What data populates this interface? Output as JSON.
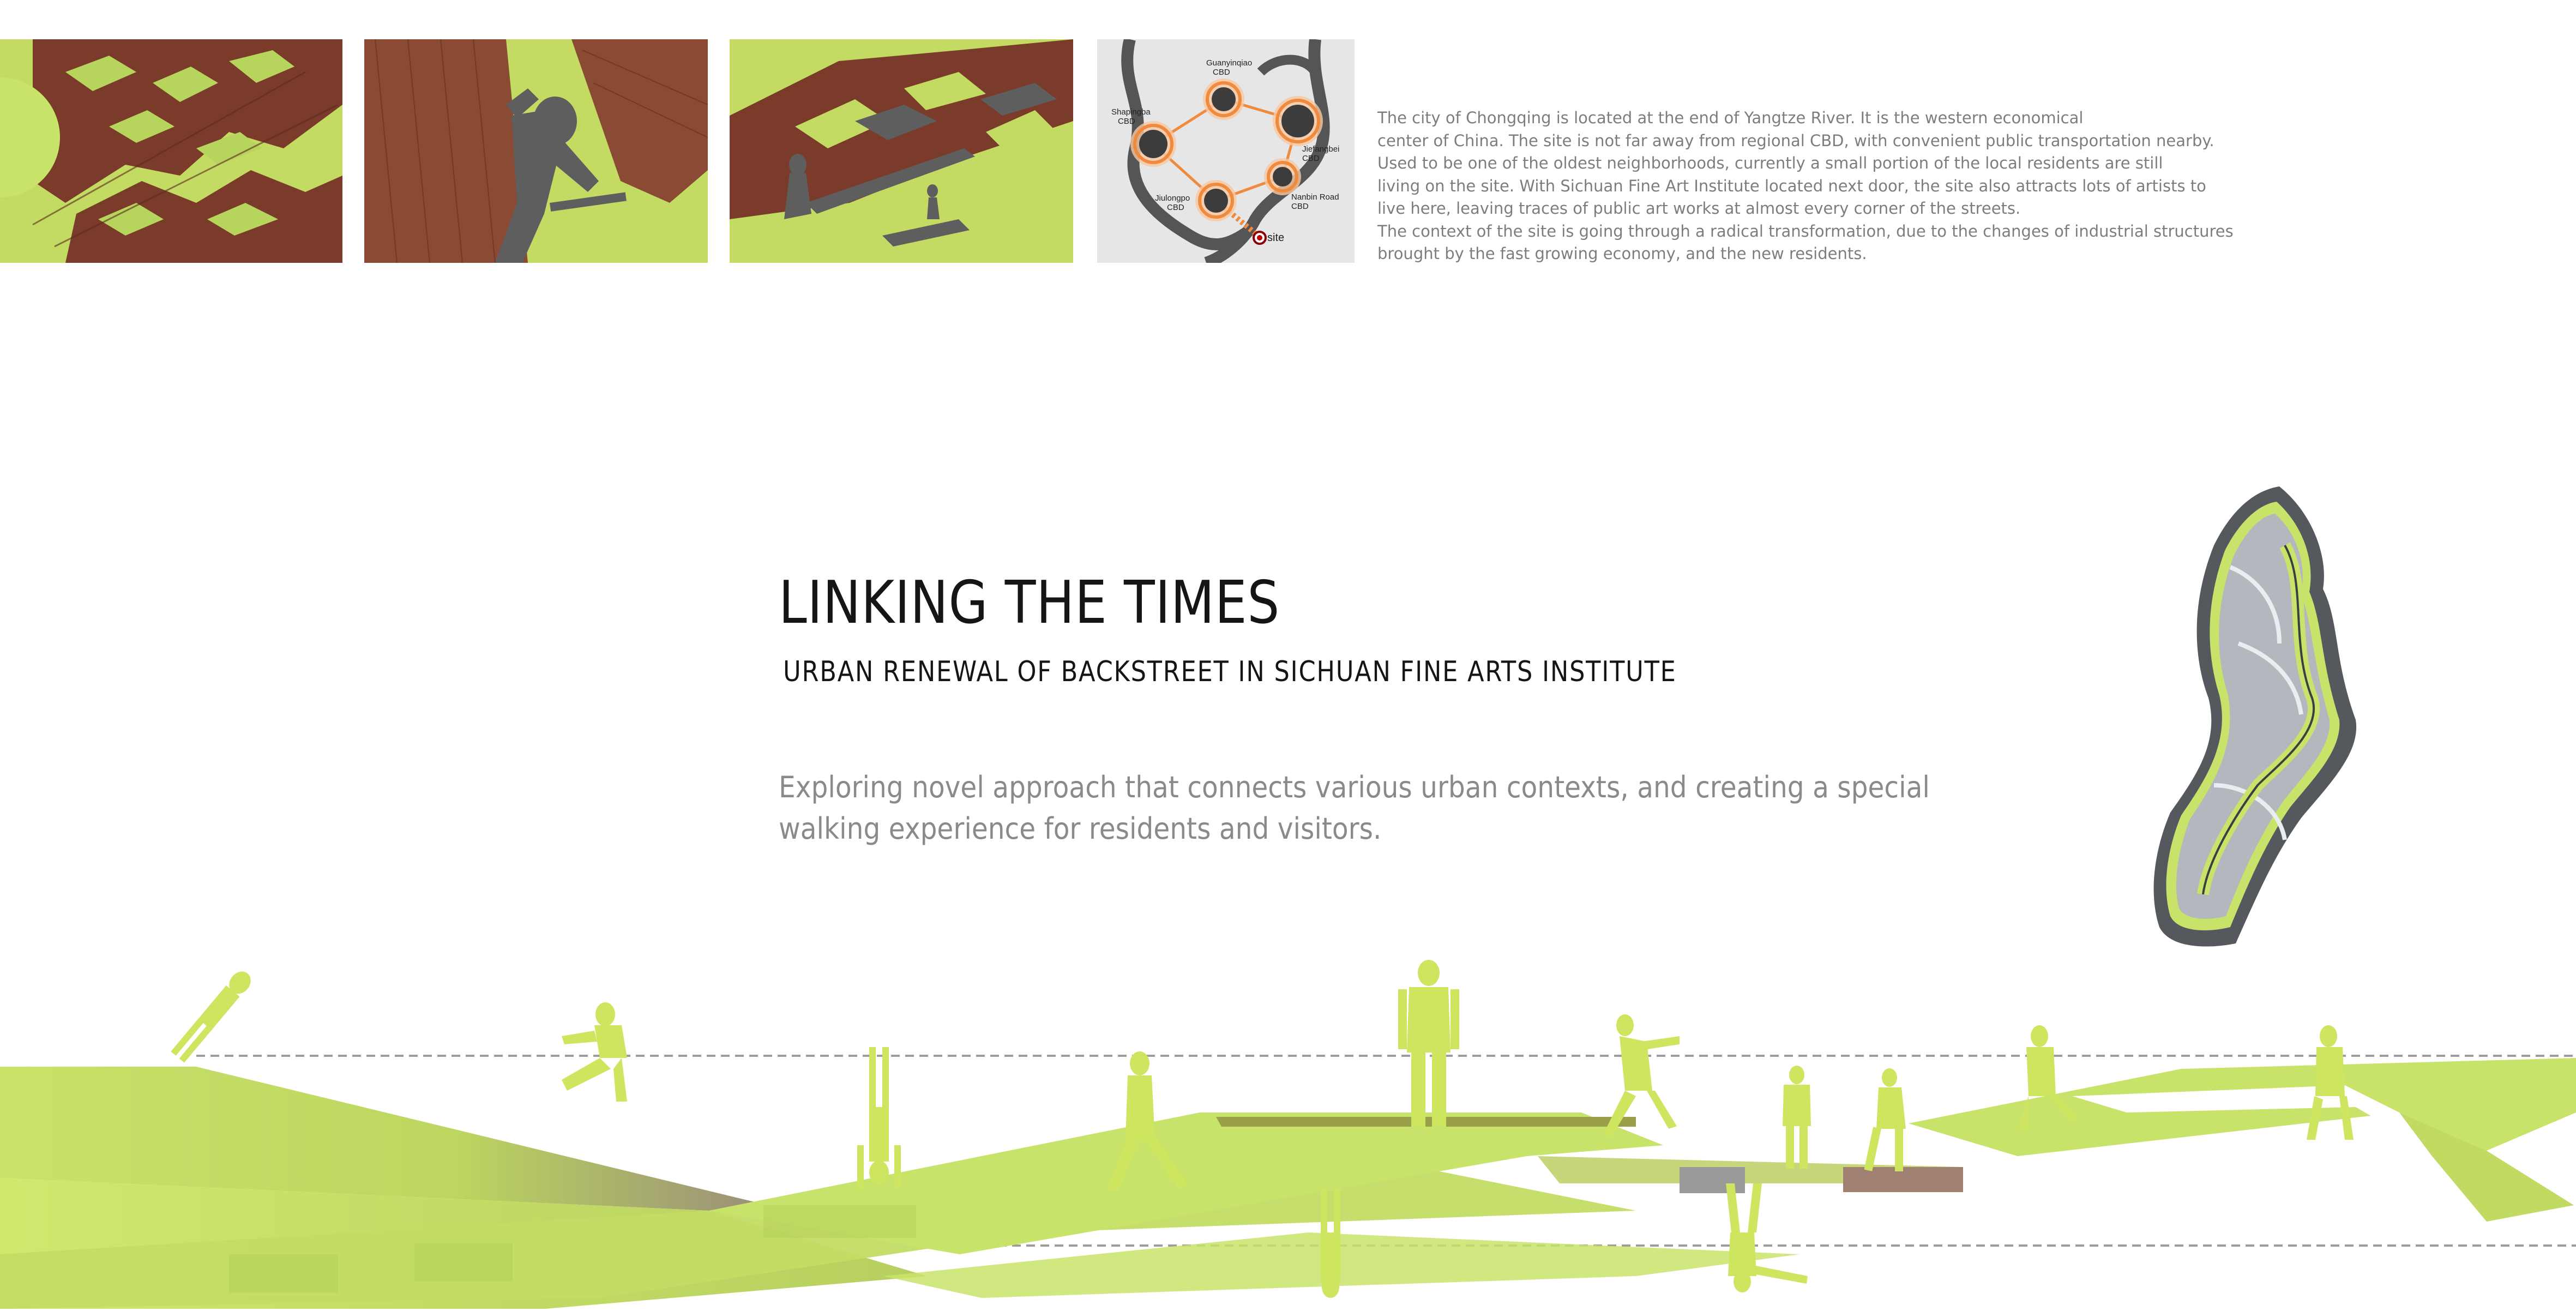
{
  "colors": {
    "accent_green": "#c8e36a",
    "figure_green": "#cde55f",
    "texture_brown": "#7a3b2a",
    "shadow_gray": "#5a5a5a",
    "map_orange": "#f08a3c",
    "text_gray": "#8a8a8a",
    "title_black": "#151515"
  },
  "thumbnails": [
    {
      "name": "aerial-texture-view"
    },
    {
      "name": "street-silhouette-view"
    },
    {
      "name": "plaza-silhouette-view"
    }
  ],
  "location_map": {
    "nodes": [
      {
        "label": "Guanyinqiao\nCBD"
      },
      {
        "label": "Shapingba\nCBD"
      },
      {
        "label": "Jiefangbei\nCBD"
      },
      {
        "label": "Jiulongpo\nCBD"
      },
      {
        "label": "Nanbin Road\nCBD"
      }
    ],
    "site_label": "site"
  },
  "context_text": "The city of Chongqing is located at the end of Yangtze River. It is the western economical\ncenter of China. The site is not far away from regional CBD, with convenient public transportation nearby.\nUsed to be one of the oldest neighborhoods, currently a small portion of the local residents are still\nliving on the site. With Sichuan Fine Art Institute located next door, the site also attracts lots of artists to\nlive here, leaving traces of public art works at almost every corner of the streets.\nThe context of the site is going through a radical transformation, due to the changes of industrial structures\nbrought by the fast growing economy, and the new residents.",
  "title": "LINKING THE TIMES",
  "subtitle": "URBAN RENEWAL OF BACKSTREET IN SICHUAN FINE ARTS INSTITUTE",
  "intro": "Exploring novel approach that connects various urban contexts, and creating a special walking experience for residents and visitors.",
  "site_plan": {
    "name": "site-plan-outline"
  },
  "section_illustration": {
    "name": "linked-walkway-section"
  }
}
